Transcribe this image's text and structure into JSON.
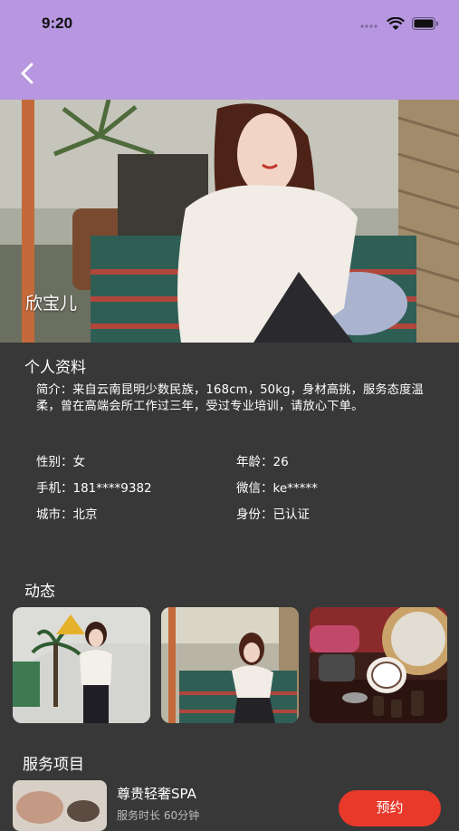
{
  "status_bar": {
    "time": "9:20"
  },
  "profile": {
    "name": "欣宝儿"
  },
  "personal_info": {
    "title": "个人资料",
    "intro": "简介：来自云南昆明少数民族，168cm，50kg，身材高挑，服务态度温柔，曾在高端会所工作过三年，受过专业培训，请放心下单。",
    "gender": "性别：女",
    "age": "年龄：26",
    "phone": "手机：181****9382",
    "wechat": "微信：ke*****",
    "city": "城市：北京",
    "identity": "身份：已认证"
  },
  "moments": {
    "title": "动态"
  },
  "services": {
    "title": "服务项目",
    "items": [
      {
        "name": "尊贵轻奢SPA",
        "subtitle": "服务时长 60分钟",
        "book_label": "预约"
      }
    ]
  },
  "colors": {
    "header": "#b797e0",
    "background": "#383838",
    "accent": "#e8392b"
  }
}
